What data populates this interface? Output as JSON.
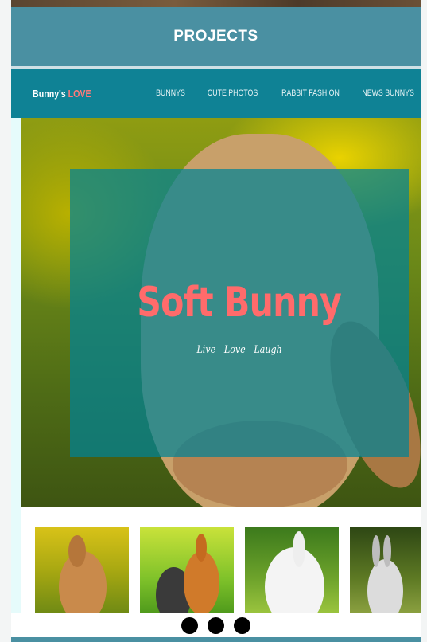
{
  "section": {
    "title": "PROJECTS"
  },
  "project": {
    "logo_main": "Bunny's ",
    "logo_accent": "LOVE",
    "menu": [
      "BUNNYS",
      "CUTE PHOTOS",
      "RABBIT FASHION",
      "NEWS BUNNYS"
    ],
    "hero_title": "Soft Bunny",
    "hero_subtitle": "Live - Love - Laugh"
  },
  "carousel": {
    "slide_count": 3
  },
  "colors": {
    "header": "#4a90a2",
    "nav": "#0f8295",
    "logo_accent": "#ff7a7a",
    "hero_title": "#ff6b6b",
    "dots": "#000000"
  }
}
